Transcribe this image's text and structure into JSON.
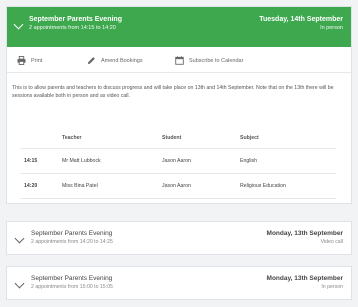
{
  "events": [
    {
      "title": "September Parents Evening",
      "subtitle": "2 appointments from 14:15 to 14:20",
      "date": "Tuesday, 14th September",
      "mode": "In person",
      "toolbar": {
        "print": "Print",
        "amend": "Amend Bookings",
        "subscribe": "Subscribe to Calendar"
      },
      "description": "This is to allow parents and teachers to discuss progress and will take place on 13th and 14th September. Note that on the 13th there will be sessions available both in person and as video call.",
      "table": {
        "headers": [
          "",
          "Teacher",
          "Student",
          "Subject"
        ],
        "rows": [
          [
            "14:15",
            "Mr Matt Lubbock",
            "Jason Aaron",
            "English"
          ],
          [
            "14:20",
            "Miss Bina Patel",
            "Jason Aaron",
            "Religious Education"
          ]
        ]
      }
    },
    {
      "title": "September Parents Evening",
      "subtitle": "2 appointments from 14:20 to 14:25",
      "date": "Monday, 13th September",
      "mode": "Video call"
    },
    {
      "title": "September Parents Evening",
      "subtitle": "2 appointments from 15:00 to 15:05",
      "date": "Monday, 13th September",
      "mode": "In person"
    }
  ],
  "icons": {
    "print": "printer-icon",
    "amend": "pencil-icon",
    "subscribe": "calendar-icon",
    "expand": "chevron-down-icon"
  },
  "colors": {
    "header_green": "#3ea84f",
    "background": "#f2f3f5"
  }
}
